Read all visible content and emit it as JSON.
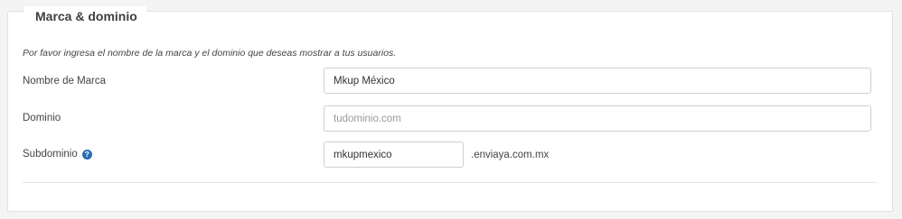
{
  "section": {
    "title": "Marca & dominio",
    "intro": "Por favor ingresa el nombre de la marca y el dominio que deseas mostrar a tus usuarios."
  },
  "fields": {
    "brand": {
      "label": "Nombre de Marca",
      "value": "Mkup México",
      "placeholder": ""
    },
    "domain": {
      "label": "Dominio",
      "value": "",
      "placeholder": "tudominio.com"
    },
    "subdomain": {
      "label": "Subdominio",
      "value": "mkupmexico",
      "placeholder": "",
      "suffix": ".enviaya.com.mx",
      "help_icon": "question-circle-icon"
    }
  },
  "colors": {
    "help_icon": "#2a6bb1"
  }
}
